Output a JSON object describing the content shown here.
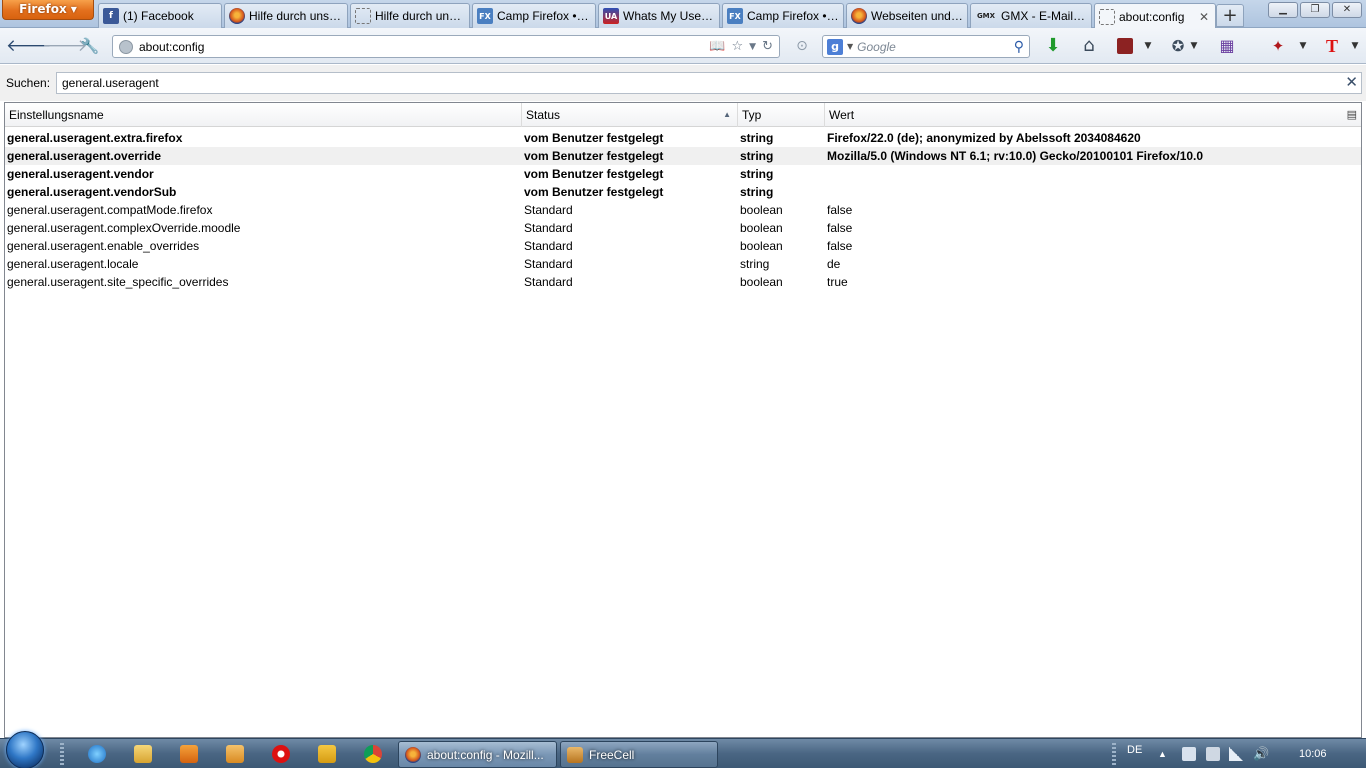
{
  "firefox_menu_label": "Firefox",
  "tabs": [
    {
      "label": "(1) Facebook",
      "favicon": "facebook-icon"
    },
    {
      "label": "Hilfe durch unse...",
      "favicon": "firefox-icon"
    },
    {
      "label": "Hilfe durch unse...",
      "favicon": "blank-page-icon"
    },
    {
      "label": "Camp Firefox • T...",
      "favicon": "camp-firefox-icon"
    },
    {
      "label": "Whats My User ...",
      "favicon": "whats-my-user-agent-icon"
    },
    {
      "label": "Camp Firefox • F...",
      "favicon": "camp-firefox-icon"
    },
    {
      "label": "Webseiten und ...",
      "favicon": "firefox-icon"
    },
    {
      "label": "GMX - E-Mail, Fr...",
      "favicon": "gmx-icon",
      "logo_text": "GMX"
    },
    {
      "label": "about:config",
      "favicon": "blank-page-icon",
      "selected": true
    }
  ],
  "url_bar": {
    "value": "about:config"
  },
  "search_bar": {
    "placeholder": "Google",
    "engine_letter": "g"
  },
  "filter": {
    "label": "Suchen:",
    "value": "general.useragent"
  },
  "columns": {
    "name": "Einstellungsname",
    "status": "Status",
    "type": "Typ",
    "value": "Wert",
    "sorted": "status"
  },
  "prefs": [
    {
      "name": "general.useragent.extra.firefox",
      "status": "vom Benutzer festgelegt",
      "type": "string",
      "value": "Firefox/22.0 (de); anonymized by Abelssoft 2034084620",
      "modified": true
    },
    {
      "name": "general.useragent.override",
      "status": "vom Benutzer festgelegt",
      "type": "string",
      "value": "Mozilla/5.0 (Windows NT 6.1; rv:10.0) Gecko/20100101 Firefox/10.0",
      "modified": true
    },
    {
      "name": "general.useragent.vendor",
      "status": "vom Benutzer festgelegt",
      "type": "string",
      "value": "",
      "modified": true
    },
    {
      "name": "general.useragent.vendorSub",
      "status": "vom Benutzer festgelegt",
      "type": "string",
      "value": "",
      "modified": true
    },
    {
      "name": "general.useragent.compatMode.firefox",
      "status": "Standard",
      "type": "boolean",
      "value": "false",
      "modified": false
    },
    {
      "name": "general.useragent.complexOverride.moodle",
      "status": "Standard",
      "type": "boolean",
      "value": "false",
      "modified": false
    },
    {
      "name": "general.useragent.enable_overrides",
      "status": "Standard",
      "type": "boolean",
      "value": "false",
      "modified": false
    },
    {
      "name": "general.useragent.locale",
      "status": "Standard",
      "type": "string",
      "value": "de",
      "modified": false
    },
    {
      "name": "general.useragent.site_specific_overrides",
      "status": "Standard",
      "type": "boolean",
      "value": "true",
      "modified": false
    }
  ],
  "taskbar": {
    "windows": [
      {
        "label": "about:config - Mozill...",
        "icon": "firefox-icon",
        "active": true
      },
      {
        "label": "FreeCell",
        "icon": "freecell-icon",
        "active": false
      }
    ],
    "language": "DE",
    "clock": "10:06"
  },
  "colors": {
    "firefox_button": "#e3701d",
    "row_alt": "#f0f0f0",
    "taskbar": "#4a6683"
  }
}
